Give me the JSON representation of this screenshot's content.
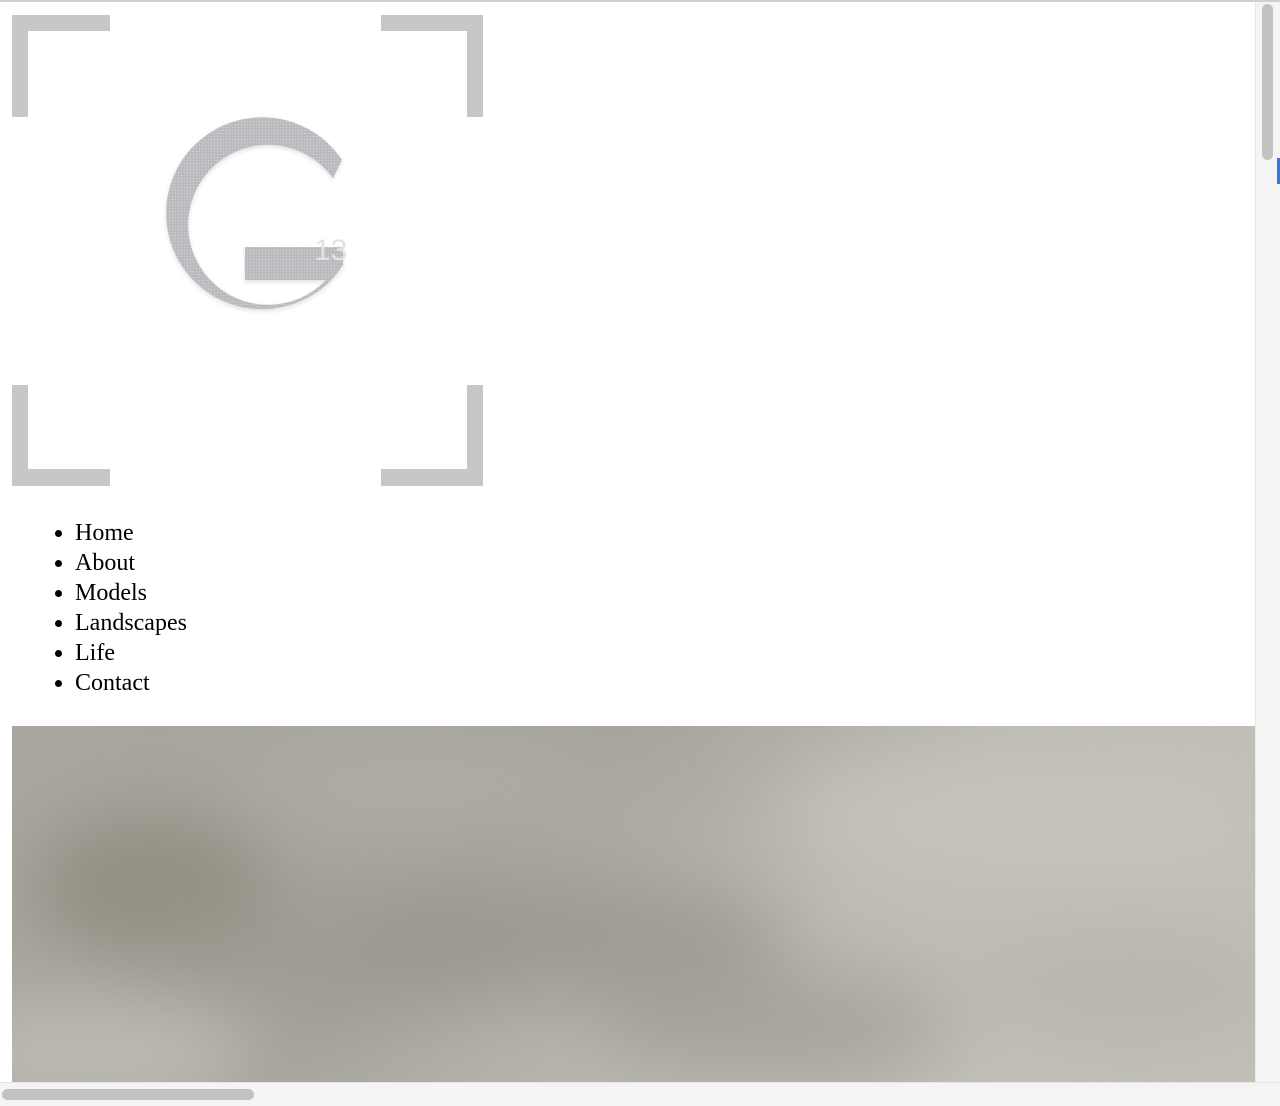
{
  "logo": {
    "letter": "G",
    "superscript": "13",
    "color": "#c6c7c9"
  },
  "nav": {
    "items": [
      {
        "label": "Home"
      },
      {
        "label": "About"
      },
      {
        "label": "Models"
      },
      {
        "label": "Landscapes"
      },
      {
        "label": "Life"
      },
      {
        "label": "Contact"
      }
    ]
  },
  "hero": {
    "image": "blurred-gray-photo",
    "tones": [
      "#8f8d83",
      "#b0aea6",
      "#c8c6be"
    ]
  },
  "scrollbars": {
    "vertical_fraction": 0.0,
    "horizontal_fraction": 0.0
  }
}
